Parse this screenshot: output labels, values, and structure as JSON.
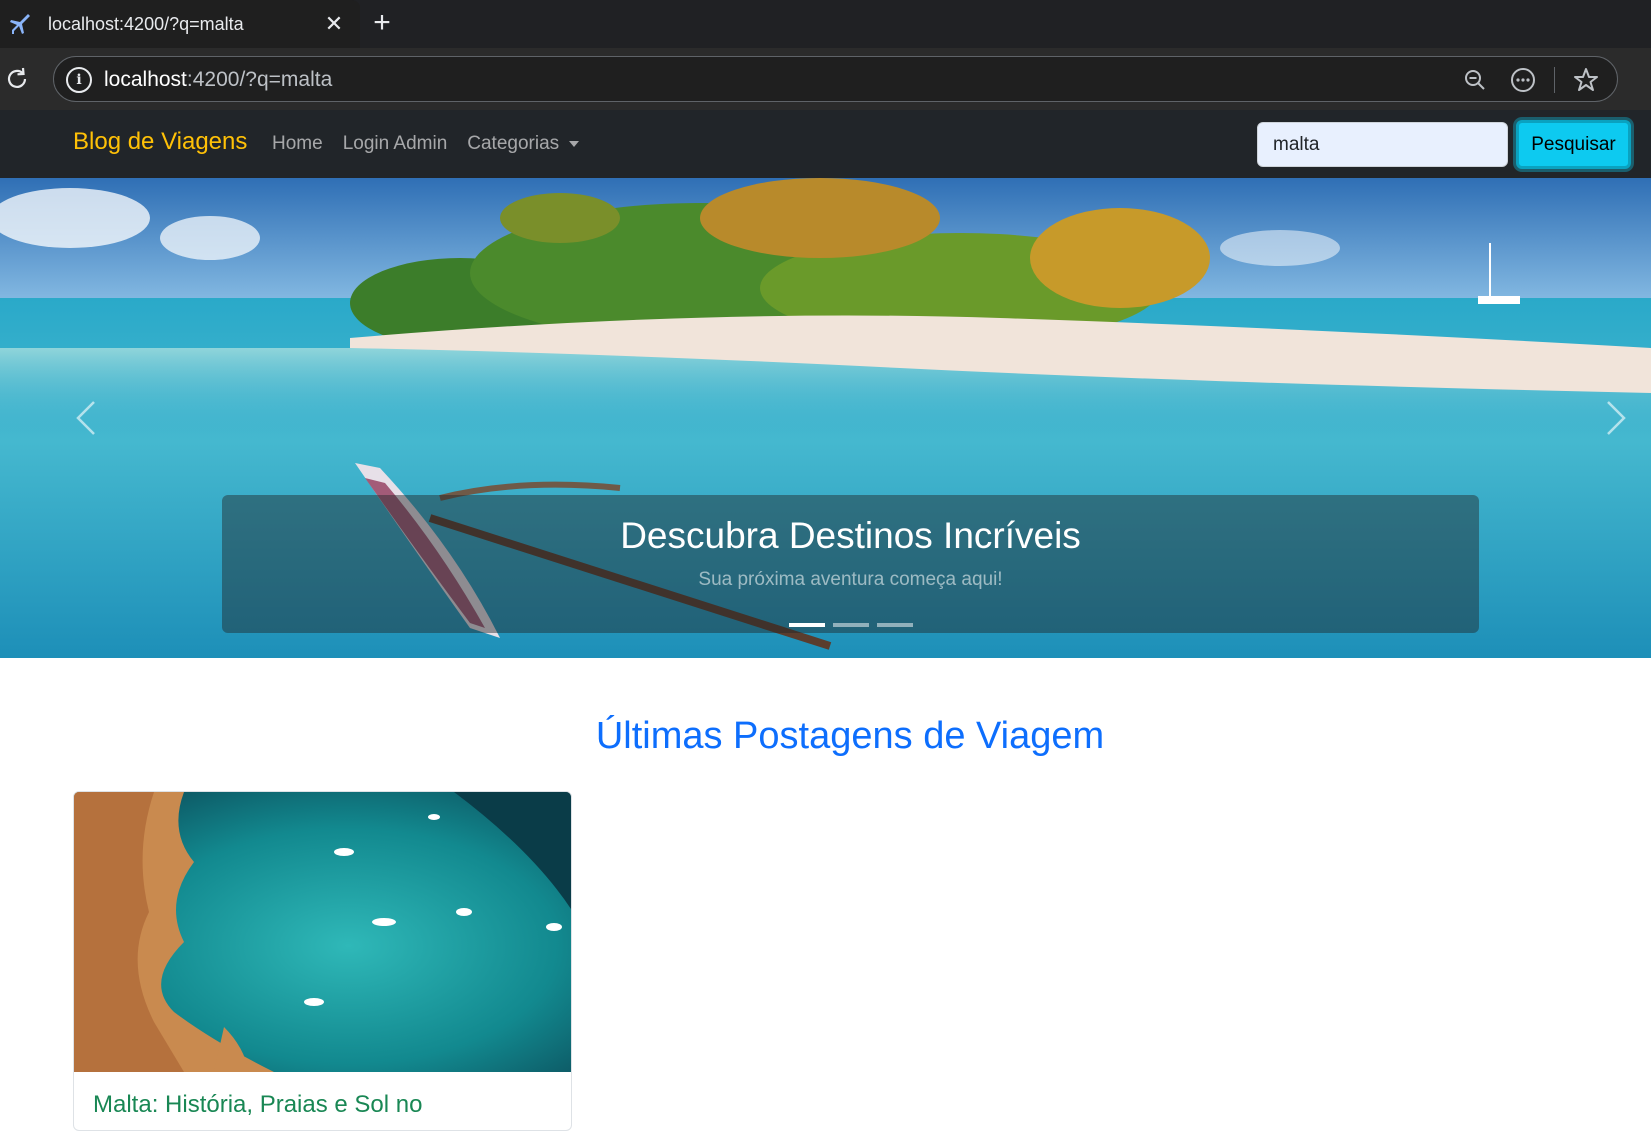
{
  "browser": {
    "tab_title": "localhost:4200/?q=malta",
    "url_host": "localhost",
    "url_rest": ":4200/?q=malta",
    "tab_icon": "airplane-icon",
    "close_icon": "close-icon",
    "new_tab_icon": "plus-icon"
  },
  "navbar": {
    "brand": "Blog de Viagens",
    "links": [
      "Home",
      "Login Admin",
      "Categorias"
    ],
    "search_value": "malta",
    "search_button": "Pesquisar"
  },
  "carousel": {
    "title": "Descubra Destinos Incríveis",
    "subtitle": "Sua próxima aventura começa aqui!",
    "slide_count": 3,
    "active_slide": 1
  },
  "section": {
    "title": "Últimas Postagens de Viagem"
  },
  "posts": [
    {
      "title": "Malta: História, Praias e Sol no"
    }
  ],
  "colors": {
    "brand": "#ffc107",
    "navbar_bg": "#212529",
    "section_title": "#0d6efd",
    "card_title": "#198754",
    "search_button": "#0dcaf0"
  }
}
